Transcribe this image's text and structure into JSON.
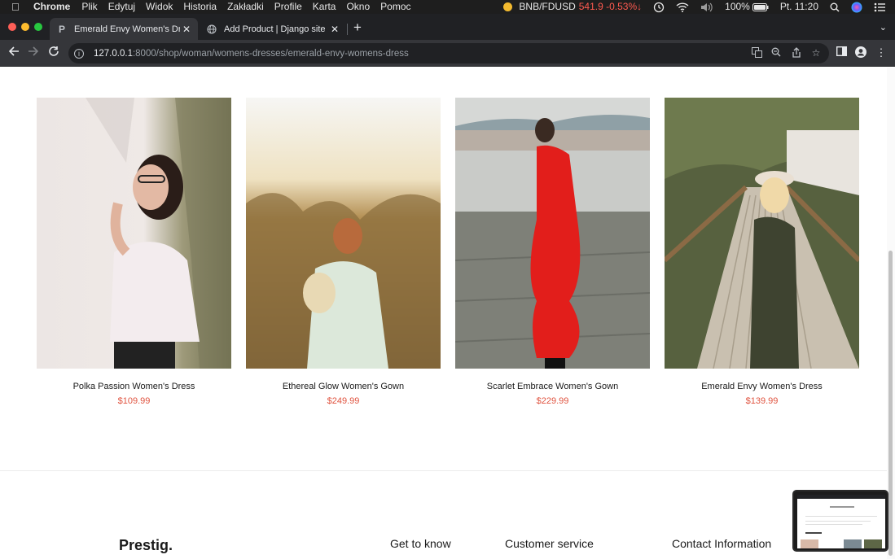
{
  "menubar": {
    "app_name": "Chrome",
    "items": [
      "Plik",
      "Edytuj",
      "Widok",
      "Historia",
      "Zakładki",
      "Profile",
      "Karta",
      "Okno",
      "Pomoc"
    ],
    "ticker_label": "BNB/FDUSD",
    "ticker_value": "541.9 -0.53%↓",
    "battery": "100%",
    "clock": "Pt. 11:20"
  },
  "tabs": [
    {
      "title": "Emerald Envy Women's Dress | ",
      "favicon": "P",
      "active": true
    },
    {
      "title": "Add Product | Django site adm",
      "favicon": "globe-icon",
      "active": false
    }
  ],
  "address_bar": {
    "host": "127.0.0.1",
    "path": ":8000/shop/woman/womens-dresses/emerald-envy-womens-dress"
  },
  "products": [
    {
      "name": "Polka Passion Women's Dress",
      "price": "$109.99"
    },
    {
      "name": "Ethereal Glow Women's Gown",
      "price": "$249.99"
    },
    {
      "name": "Scarlet Embrace Women's Gown",
      "price": "$229.99"
    },
    {
      "name": "Emerald Envy Women's Dress",
      "price": "$139.99"
    }
  ],
  "footer": {
    "brand": "Prestig.",
    "headings": [
      "Get to know",
      "Customer service",
      "Contact Information"
    ]
  },
  "colors": {
    "price": "#e0533f",
    "chrome_dark": "#202124",
    "chrome_toolbar": "#35363a"
  }
}
